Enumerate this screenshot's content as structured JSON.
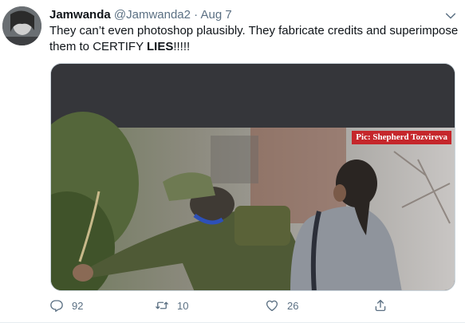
{
  "tweet": {
    "author_name": "Jamwanda",
    "author_handle": "@Jamwanda2",
    "separator": "·",
    "date": "Aug 7",
    "text_before_bold": "They can’t even photoshop plausibly. They fabricate credits and superimpose them to CERTIFY ",
    "text_bold": "LIES",
    "text_after_bold": "!!!!!",
    "media": {
      "credit_label": "Pic: Shepherd Tozvireva"
    },
    "actions": {
      "reply_count": "92",
      "retweet_count": "10",
      "like_count": "26"
    }
  },
  "icons": {
    "more": "chevron-down-icon",
    "reply": "reply-icon",
    "retweet": "retweet-icon",
    "like": "heart-icon",
    "share": "share-icon"
  },
  "colors": {
    "text_primary": "#0f1419",
    "text_secondary": "#5b7083",
    "credit_background": "#c5262b"
  }
}
